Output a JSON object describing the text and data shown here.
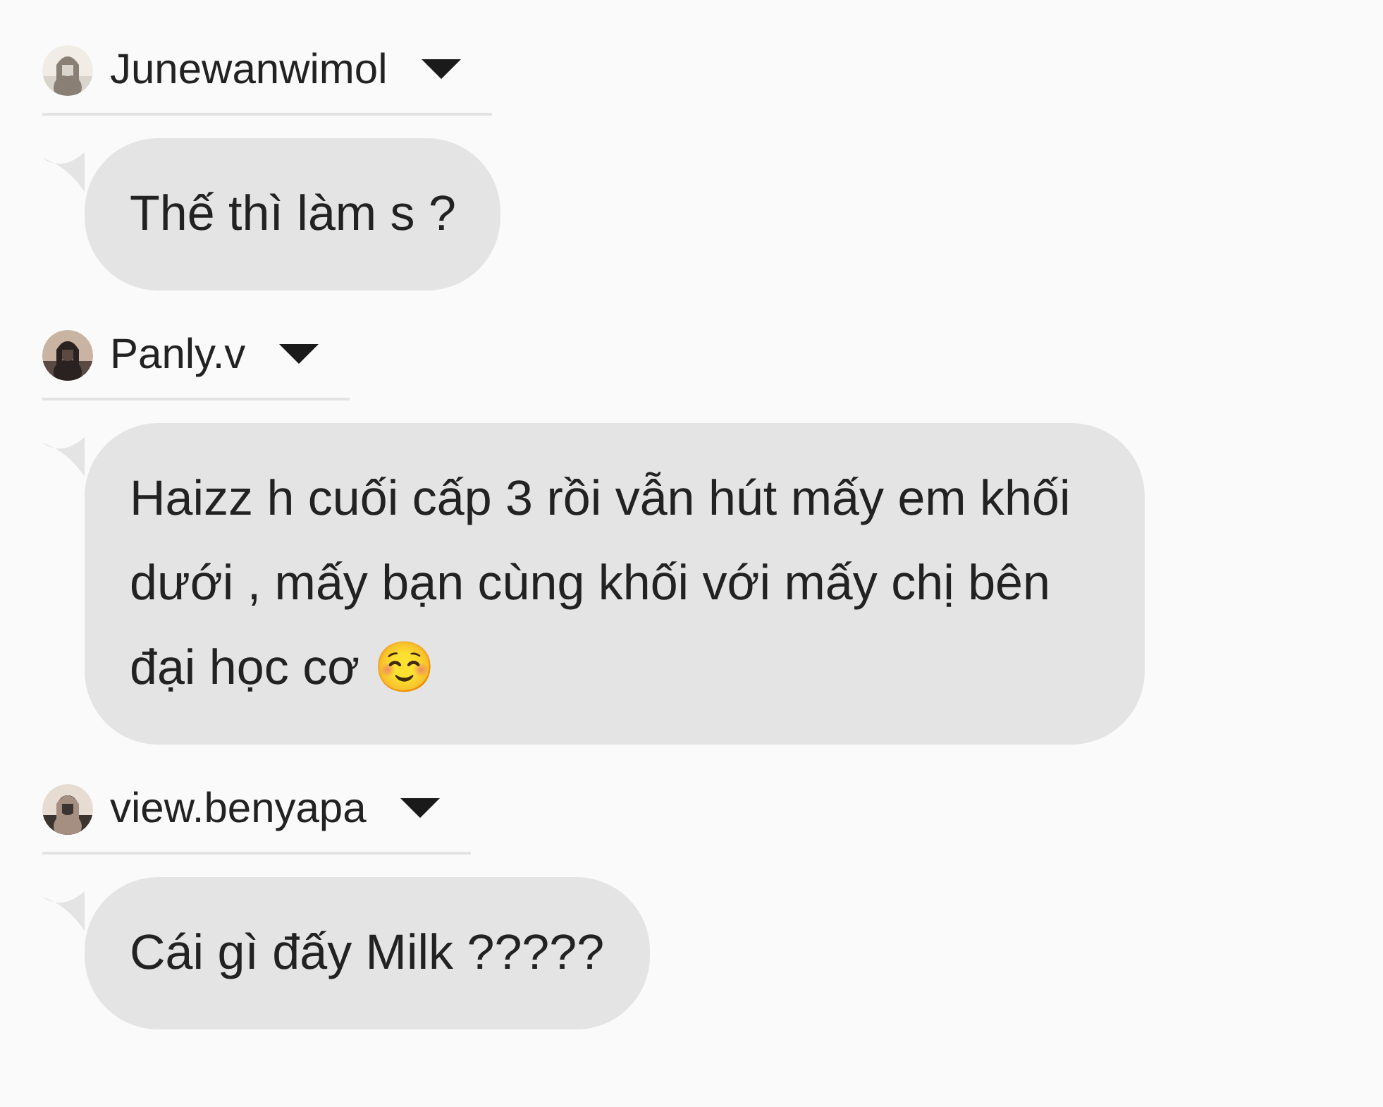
{
  "messages": [
    {
      "sender": "Junewanwimol",
      "text": "Thế thì làm s ?"
    },
    {
      "sender": "Panly.v",
      "text": "Haizz h cuối cấp 3 rồi vẫn hút mấy em khối dưới , mấy bạn cùng khối với mấy chị bên đại học cơ ☺️"
    },
    {
      "sender": "view.benyapa",
      "text": "Cái gì đấy Milk ?????"
    }
  ]
}
